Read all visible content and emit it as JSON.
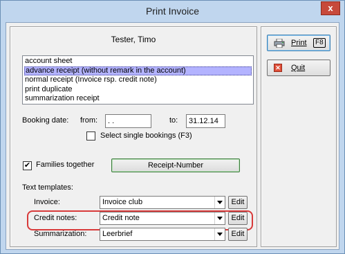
{
  "window": {
    "title": "Print Invoice",
    "close_glyph": "x"
  },
  "customer": {
    "name": "Tester, Timo"
  },
  "print_types": {
    "items": [
      "account sheet",
      "advance receipt (without remark in the account)",
      "normal receipt (Invoice rsp. credit note)",
      "print duplicate",
      "summarization receipt"
    ],
    "selected_index": 1
  },
  "booking_date": {
    "label": "Booking date:",
    "from_label": "from:",
    "from_value": " .  .",
    "to_label": "to:",
    "to_value": "31.12.14"
  },
  "select_single": {
    "label": "Select single bookings (F3)",
    "checked": false
  },
  "families_together": {
    "label": "Families together",
    "checked": true,
    "check_glyph": "✔"
  },
  "receipt_number_button": {
    "label": "Receipt-Number"
  },
  "text_templates": {
    "heading": "Text templates:",
    "rows": [
      {
        "label": "Invoice:",
        "value": "Invoice club",
        "edit_label": "Edit"
      },
      {
        "label": "Credit notes:",
        "value": "Credit note",
        "edit_label": "Edit"
      },
      {
        "label": "Summarization:",
        "value": "Leerbrief",
        "edit_label": "Edit"
      }
    ]
  },
  "sidebar": {
    "print_button": {
      "label": "Print",
      "shortcut": "F8",
      "icon": "printer-icon"
    },
    "quit_button": {
      "label": "Quit",
      "icon": "quit-icon",
      "icon_glyph": "✕"
    }
  },
  "colors": {
    "selection": "#b3b3ff",
    "highlight": "#d83a3a",
    "window_frame": "#c0d6ee"
  }
}
